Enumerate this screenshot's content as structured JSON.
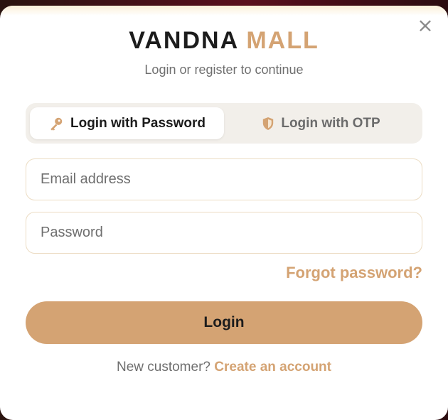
{
  "brand": {
    "part1": "VANDNA",
    "part2": "MALL"
  },
  "subtitle": "Login or register to continue",
  "close_symbol": "×",
  "tabs": [
    {
      "label": "Login with Password",
      "icon": "key-icon",
      "active": true
    },
    {
      "label": "Login with OTP",
      "icon": "shield-icon",
      "active": false
    }
  ],
  "form": {
    "email_placeholder": "Email address",
    "password_placeholder": "Password",
    "forgot_label": "Forgot password?",
    "login_label": "Login"
  },
  "footer": {
    "prompt": "New customer?",
    "create_label": "Create an account"
  },
  "colors": {
    "accent": "#d4a373",
    "text_dark": "#1c1c1c",
    "text_muted": "#6f6f6f",
    "tab_bg": "#f2efea",
    "field_border": "#ecdcc3"
  }
}
